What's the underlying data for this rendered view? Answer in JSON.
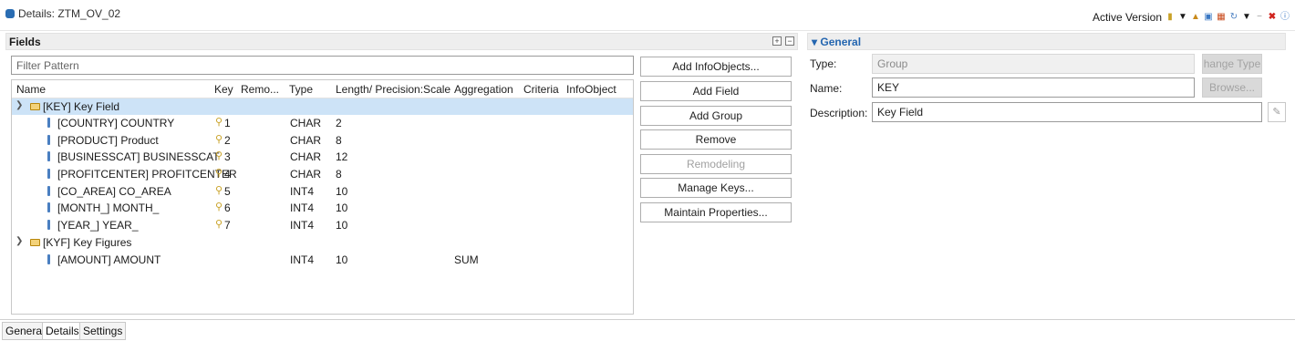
{
  "window": {
    "title": "Details: ZTM_OV_02"
  },
  "toolbar": {
    "version_label": "Active Version"
  },
  "fields_panel": {
    "title": "Fields",
    "filter_placeholder": "Filter Pattern",
    "columns": [
      "Name",
      "Key",
      "Remo...",
      "Type",
      "Length/ Precision:Scale",
      "Aggregation",
      "Criteria",
      "InfoObject"
    ],
    "rows": [
      {
        "kind": "group",
        "name": "[KEY] Key Field",
        "key": "",
        "type": "",
        "length": "",
        "aggregation": "",
        "selected": true
      },
      {
        "kind": "field",
        "name": "[COUNTRY] COUNTRY",
        "key": "1",
        "type": "CHAR",
        "length": "2",
        "aggregation": ""
      },
      {
        "kind": "field",
        "name": "[PRODUCT] Product",
        "key": "2",
        "type": "CHAR",
        "length": "8",
        "aggregation": ""
      },
      {
        "kind": "field",
        "name": "[BUSINESSCAT] BUSINESSCAT",
        "key": "3",
        "type": "CHAR",
        "length": "12",
        "aggregation": ""
      },
      {
        "kind": "field",
        "name": "[PROFITCENTER] PROFITCENTER",
        "key": "4",
        "type": "CHAR",
        "length": "8",
        "aggregation": ""
      },
      {
        "kind": "field",
        "name": "[CO_AREA] CO_AREA",
        "key": "5",
        "type": "INT4",
        "length": "10",
        "aggregation": ""
      },
      {
        "kind": "field",
        "name": "[MONTH_] MONTH_",
        "key": "6",
        "type": "INT4",
        "length": "10",
        "aggregation": ""
      },
      {
        "kind": "field",
        "name": "[YEAR_] YEAR_",
        "key": "7",
        "type": "INT4",
        "length": "10",
        "aggregation": ""
      },
      {
        "kind": "group",
        "name": "[KYF] Key Figures",
        "key": "",
        "type": "",
        "length": "",
        "aggregation": ""
      },
      {
        "kind": "field",
        "name": "[AMOUNT] AMOUNT",
        "key": "",
        "type": "INT4",
        "length": "10",
        "aggregation": "SUM"
      }
    ]
  },
  "actions": {
    "add_infoobjects": "Add InfoObjects...",
    "add_field": "Add Field",
    "add_group": "Add Group",
    "remove": "Remove",
    "remodeling": "Remodeling",
    "manage_keys": "Manage Keys...",
    "maintain_properties": "Maintain Properties..."
  },
  "general": {
    "title": "General",
    "type_label": "Type:",
    "type_value": "Group",
    "change_type": "hange Type",
    "name_label": "Name:",
    "name_value": "KEY",
    "browse": "Browse...",
    "description_label": "Description:",
    "description_value": "Key Field"
  },
  "tabs": [
    "General",
    "Details",
    "Settings"
  ]
}
